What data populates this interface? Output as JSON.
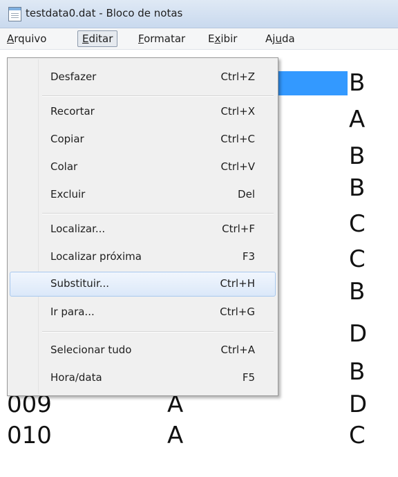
{
  "window": {
    "title": "testdata0.dat - Bloco de notas",
    "icon": "notepad-icon"
  },
  "menubar": {
    "arquivo": {
      "u": "A",
      "rest": "rquivo"
    },
    "editar": {
      "u": "E",
      "rest": "ditar"
    },
    "formatar": {
      "u": "F",
      "rest": "ormatar"
    },
    "exibir": {
      "pre": "E",
      "u": "x",
      "rest": "ibir"
    },
    "ajuda": {
      "pre": "Aj",
      "u": "u",
      "rest": "da"
    }
  },
  "edit_menu": {
    "items": [
      {
        "label": "Desfazer",
        "shortcut": "Ctrl+Z"
      },
      {
        "label": "Recortar",
        "shortcut": "Ctrl+X"
      },
      {
        "label": "Copiar",
        "shortcut": "Ctrl+C"
      },
      {
        "label": "Colar",
        "shortcut": "Ctrl+V"
      },
      {
        "label": "Excluir",
        "shortcut": "Del"
      },
      {
        "label": "Localizar...",
        "shortcut": "Ctrl+F"
      },
      {
        "label": "Localizar próxima",
        "shortcut": "F3"
      },
      {
        "label": "Substituir...",
        "shortcut": "Ctrl+H"
      },
      {
        "label": "Ir para...",
        "shortcut": "Ctrl+G"
      },
      {
        "label": "Selecionar tudo",
        "shortcut": "Ctrl+A"
      },
      {
        "label": "Hora/data",
        "shortcut": "F5"
      }
    ]
  },
  "document": {
    "visible_right_column": [
      "B",
      "A",
      "B",
      "B",
      "C",
      "C",
      "B",
      "D",
      "B"
    ],
    "rows": [
      {
        "c1": "009",
        "c2": "A",
        "c3": "D"
      },
      {
        "c1": "010",
        "c2": "A",
        "c3": "C"
      }
    ]
  },
  "selection_color": "#3399ff"
}
